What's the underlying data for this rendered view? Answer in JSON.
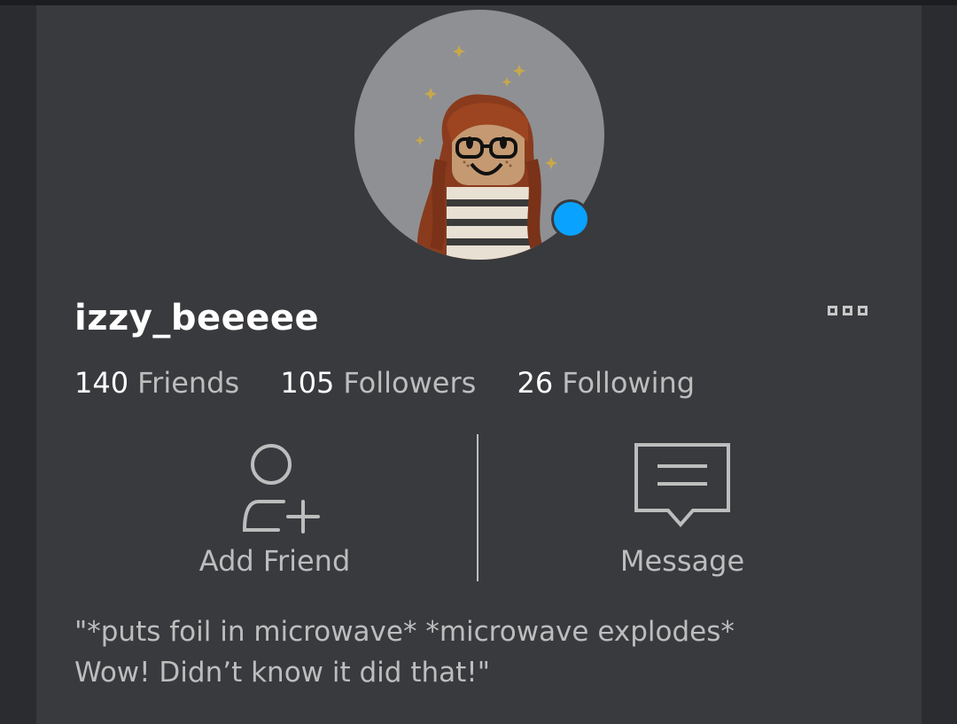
{
  "profile": {
    "username": "izzy_beeeee",
    "online": true,
    "colors": {
      "presence": "#0aa2ff",
      "background": "#393a3d",
      "muted_text": "#bdbdbe"
    }
  },
  "stats": [
    {
      "count": "140",
      "label": "Friends"
    },
    {
      "count": "105",
      "label": "Followers"
    },
    {
      "count": "26",
      "label": "Following"
    }
  ],
  "actions": {
    "add_friend": {
      "label": "Add Friend",
      "icon": "add-friend-icon"
    },
    "message": {
      "label": "Message",
      "icon": "message-icon"
    }
  },
  "more_menu": {
    "icon": "more-options-icon"
  },
  "bio": {
    "line1": "\"*puts foil in microwave* *microwave explodes*",
    "line2": "Wow! Didn’t know it did that!\""
  }
}
